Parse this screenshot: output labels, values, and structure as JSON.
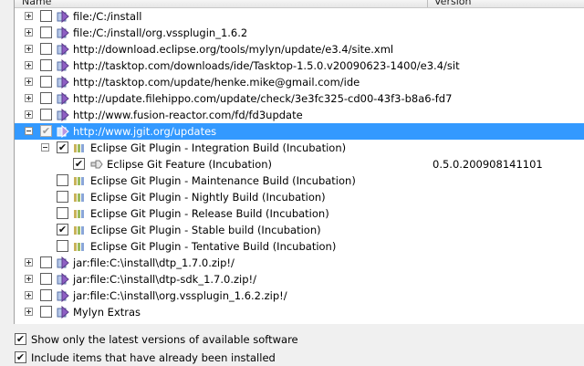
{
  "header": {
    "name_col": "Name",
    "version_col": "Version"
  },
  "sites": [
    "file:/C:/install",
    "file:/C:/install/org.vssplugin_1.6.2",
    "http://download.eclipse.org/tools/mylyn/update/e3.4/site.xml",
    "http://tasktop.com/downloads/ide/Tasktop-1.5.0.v20090623-1400/e3.4/sit",
    "http://tasktop.com/update/henke.mike@gmail.com/ide",
    "http://update.filehippo.com/update/check/3e3fc325-cd00-43f3-b8a6-fd7",
    "http://www.fusion-reactor.com/fd/fd3update"
  ],
  "selected_site": "http://www.jgit.org/updates",
  "category": "Eclipse Git Plugin - Integration Build (Incubation)",
  "feature": {
    "label": "Eclipse Git Feature (Incubation)",
    "version": "0.5.0.200908141101"
  },
  "other_categories": [
    "Eclipse Git Plugin - Maintenance Build (Incubation)",
    "Eclipse Git Plugin - Nightly Build (Incubation)",
    "Eclipse Git Plugin - Release Build (Incubation)",
    "Eclipse Git Plugin - Stable build (Incubation)",
    "Eclipse Git Plugin - Tentative Build (Incubation)"
  ],
  "more_sites": [
    "jar:file:C:\\install\\dtp_1.7.0.zip!/",
    "jar:file:C:\\install\\dtp-sdk_1.7.0.zip!/",
    "jar:file:C:\\install\\org.vssplugin_1.6.2.zip!/",
    "Mylyn Extras"
  ],
  "options": {
    "show_latest": "Show only the latest versions of available software",
    "include_installed": "Include items that have already been installed"
  },
  "colors": {
    "selection": "#3399ff"
  }
}
